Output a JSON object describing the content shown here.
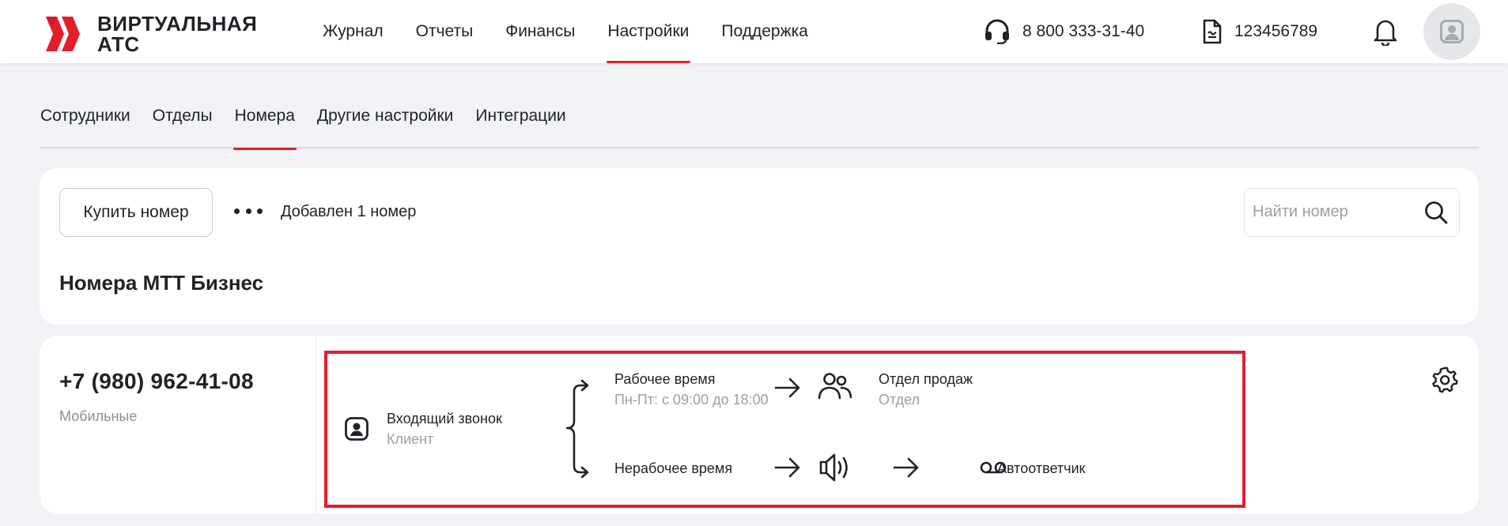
{
  "brand": {
    "line1": "ВИРТУАЛЬНАЯ",
    "line2": "АТС",
    "accent_color": "#e31e2b",
    "logo_icon": "double-chevron-logo"
  },
  "nav": {
    "items": [
      {
        "label": "Журнал",
        "active": false
      },
      {
        "label": "Отчеты",
        "active": false
      },
      {
        "label": "Финансы",
        "active": false
      },
      {
        "label": "Настройки",
        "active": true
      },
      {
        "label": "Поддержка",
        "active": false
      }
    ]
  },
  "header": {
    "support_phone": "8 800 333-31-40",
    "support_icon": "headset-icon",
    "account_number": "123456789",
    "account_icon": "document-icon",
    "notifications_icon": "bell-icon",
    "avatar_icon": "user-avatar-icon"
  },
  "subtabs": [
    {
      "label": "Сотрудники",
      "active": false
    },
    {
      "label": "Отделы",
      "active": false
    },
    {
      "label": "Номера",
      "active": true
    },
    {
      "label": "Другие настройки",
      "active": false
    },
    {
      "label": "Интеграции",
      "active": false
    }
  ],
  "toolbar": {
    "buy_label": "Купить номер",
    "more_icon": "more-dots-icon",
    "added_text": "Добавлен 1 номер",
    "search_placeholder": "Найти номер",
    "search_icon": "search-icon"
  },
  "section_title": "Номера МТТ Бизнес",
  "number_card": {
    "phone": "+7 (980) 962-41-08",
    "type": "Мобильные",
    "settings_icon": "gear-icon",
    "route": {
      "incoming": {
        "label": "Входящий звонок",
        "sub": "Клиент",
        "icon": "contact-icon"
      },
      "work_time": {
        "label": "Рабочее время",
        "sub": "Пн-Пт: с 09:00 до 18:00"
      },
      "target_work": {
        "label": "Отдел продаж",
        "sub": "Отдел",
        "icon": "group-icon"
      },
      "off_time": {
        "label": "Нерабочее время"
      },
      "announcement_icon": "speaker-icon",
      "target_off": {
        "label": "Автоответчик",
        "icon": "voicemail-icon"
      },
      "highlight_color": "#e31e2b"
    }
  }
}
